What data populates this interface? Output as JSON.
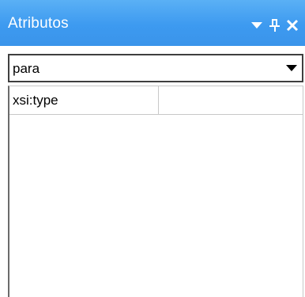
{
  "panel": {
    "title": "Atributos",
    "buttons": {
      "menu_icon": "chevron-down-icon",
      "pin_icon": "pin-icon",
      "close_icon": "close-icon"
    }
  },
  "element_selector": {
    "selected": "para"
  },
  "attributes_table": {
    "rows": [
      {
        "name": "xsi:type",
        "value": ""
      }
    ]
  },
  "colors": {
    "titlebar": "#3d9af0",
    "title_text": "#ffffff",
    "border": "#3f3f3f",
    "grid_lines": "#c8c8c8"
  }
}
